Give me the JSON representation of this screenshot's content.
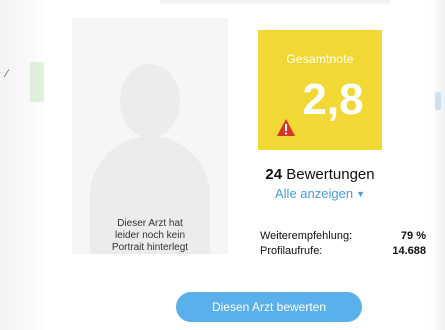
{
  "colors": {
    "rating_box": "#f2d835",
    "warning": "#d9342b",
    "link": "#4a9be0",
    "button": "#5ab0ea"
  },
  "portrait": {
    "note_lines": [
      "Dieser Arzt hat",
      "leider noch kein",
      "Portrait hinterlegt"
    ],
    "icon": "user-silhouette-icon"
  },
  "rating": {
    "label": "Gesamtnote",
    "value": "2,8",
    "icon": "warning-triangle-icon"
  },
  "reviews": {
    "count": "24",
    "label": "Bewertungen",
    "show_all": "Alle anzeigen",
    "show_all_icon": "chevron-down-icon"
  },
  "stats": {
    "recommendation_label": "Weiterempfehlung:",
    "recommendation_value": "79 %",
    "profile_views_label": "Profilaufrufe:",
    "profile_views_value": "14.688"
  },
  "actions": {
    "rate_button": "Diesen Arzt bewerten"
  }
}
